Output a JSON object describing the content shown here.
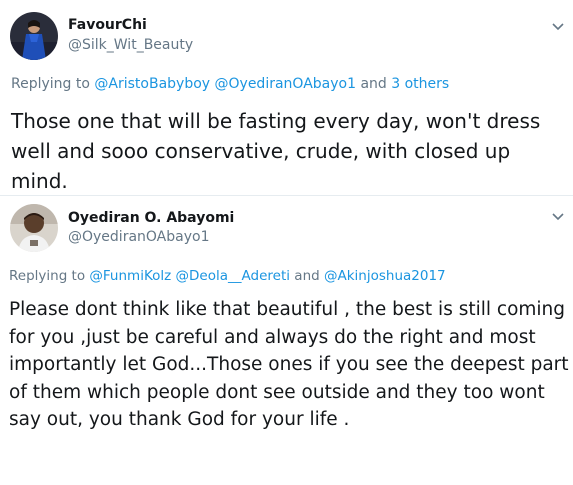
{
  "tweets": [
    {
      "display_name": "FavourChi",
      "handle": "@Silk_Wit_Beauty",
      "replying_prefix": "Replying to",
      "mentions": [
        "@AristoBabyboy",
        "@OyediranOAbayo1"
      ],
      "replying_conjunction": "and",
      "replying_others": "3 others",
      "text": "Those one that will be fasting every day, won't dress well and sooo conservative, crude, with closed up mind."
    },
    {
      "display_name": "Oyediran O. Abayomi",
      "handle": "@OyediranOAbayo1",
      "replying_prefix": "Replying to",
      "mentions": [
        "@FunmiKolz",
        "@Deola__Adereti"
      ],
      "replying_conjunction": "and",
      "replying_last_mention": "@Akinjoshua2017",
      "text": "Please dont think like that beautiful , the best is still coming for you ,just be careful and always do the right and most importantly let God...Those ones if you see the deepest part of them which people dont see outside and they too wont say out, you thank God for your life ."
    }
  ],
  "icons": {
    "tweet1_avatar": "profile-photo-woman-blue-dress",
    "tweet2_avatar": "profile-photo-man",
    "more_menu": "chevron-down-icon"
  },
  "colors": {
    "link": "#1b95e0",
    "secondary_text": "#657786",
    "primary_text": "#14171a",
    "divider": "#e6ecf0"
  }
}
